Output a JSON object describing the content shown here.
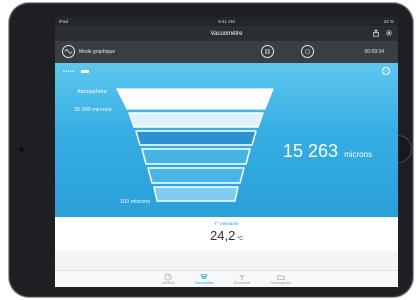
{
  "status": {
    "carrier": "iPad",
    "time": "9:41 AM",
    "battery": "42 %"
  },
  "nav": {
    "title": "Vacuomètre"
  },
  "toolbar": {
    "mode_label": "Mode graphique",
    "timer": "00:09:34"
  },
  "main": {
    "atmosphere_label": "Atmosphère",
    "top_label": "25 000 microns",
    "bottom_label": "100 microns",
    "reading_value": "15 263",
    "reading_unit": "microns",
    "active_band": 2
  },
  "temperature": {
    "label": "T° ambiante",
    "value": "24,2",
    "unit": "°C"
  },
  "tabs": [
    {
      "label": "Manifold",
      "icon": "gauge-icon"
    },
    {
      "label": "Vacuomètre",
      "icon": "funnel-icon",
      "active": true
    },
    {
      "label": "Surchauffe",
      "icon": "fan-icon"
    },
    {
      "label": "Sauvegardes",
      "icon": "folder-icon"
    }
  ],
  "colors": {
    "accent": "#2aa6dc",
    "panel_top": "#5ec7ee",
    "panel_bottom": "#2a9fd8"
  }
}
